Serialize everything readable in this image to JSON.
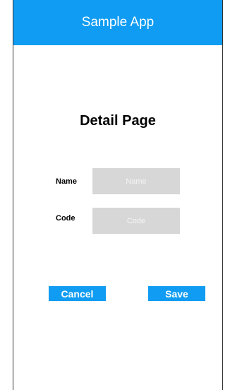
{
  "header": {
    "title": "Sample App"
  },
  "page": {
    "title": "Detail Page"
  },
  "form": {
    "name": {
      "label": "Name",
      "placeholder": "Name",
      "value": ""
    },
    "code": {
      "label": "Code",
      "placeholder": "Code",
      "value": ""
    }
  },
  "actions": {
    "cancel_label": "Cancel",
    "save_label": "Save"
  },
  "colors": {
    "accent": "#109cf2",
    "input_bg": "#d7d7d7"
  }
}
